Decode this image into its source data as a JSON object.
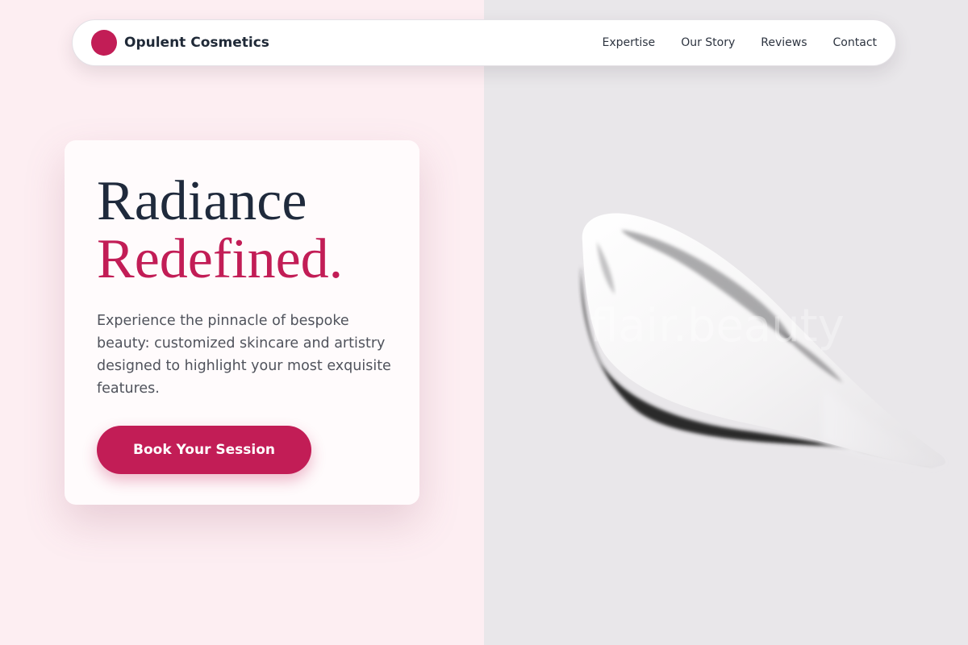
{
  "brand": {
    "name": "Opulent Cosmetics",
    "logo_icon": "circle-logo-icon",
    "accent": "#c21d56"
  },
  "nav": {
    "links": [
      {
        "label": "Expertise"
      },
      {
        "label": "Our Story"
      },
      {
        "label": "Reviews"
      },
      {
        "label": "Contact"
      }
    ]
  },
  "hero": {
    "headline_line1": "Radiance",
    "headline_line2": "Redefined.",
    "description": "Experience the pinnacle of bespoke beauty: customized skincare and artistry designed to highlight your most exquisite features.",
    "cta_label": "Book Your Session"
  },
  "image": {
    "subject": "cream-swatch-image",
    "watermark": "flair.beauty"
  },
  "colors": {
    "left_background": "#fdeef2",
    "right_background": "#e9e7ea",
    "headline_dark": "#1f2a3c",
    "headline_accent": "#c21d56"
  }
}
